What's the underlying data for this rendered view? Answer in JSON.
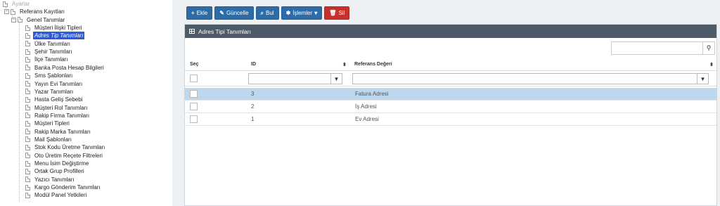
{
  "tree": {
    "items": [
      {
        "label": "Ayarlar",
        "level": 0,
        "type": "root"
      },
      {
        "label": "Referans Kayıtları",
        "level": 1,
        "type": "folder"
      },
      {
        "label": "Genel Tanımlar",
        "level": 2,
        "type": "folder"
      },
      {
        "label": "Müşteri İlişki Tipleri",
        "level": 3,
        "type": "leaf"
      },
      {
        "label": "Adres Tip Tanımları",
        "level": 3,
        "type": "leaf",
        "selected": true
      },
      {
        "label": "Ülke Tanımları",
        "level": 3,
        "type": "leaf"
      },
      {
        "label": "Şehir Tanımları",
        "level": 3,
        "type": "leaf"
      },
      {
        "label": "İlçe Tanımları",
        "level": 3,
        "type": "leaf"
      },
      {
        "label": "Banka Posta Hesap Bilgileri",
        "level": 3,
        "type": "leaf"
      },
      {
        "label": "Sms Şablonları",
        "level": 3,
        "type": "leaf"
      },
      {
        "label": "Yayın Evi Tanımları",
        "level": 3,
        "type": "leaf"
      },
      {
        "label": "Yazar Tanımları",
        "level": 3,
        "type": "leaf"
      },
      {
        "label": "Hasta Geliş Sebebi",
        "level": 3,
        "type": "leaf"
      },
      {
        "label": "Müşteri Rol Tanımları",
        "level": 3,
        "type": "leaf"
      },
      {
        "label": "Rakip Firma Tanımları",
        "level": 3,
        "type": "leaf"
      },
      {
        "label": "Müşteri Tipleri",
        "level": 3,
        "type": "leaf"
      },
      {
        "label": "Rakip Marka Tanımları",
        "level": 3,
        "type": "leaf"
      },
      {
        "label": "Mail Şablonları",
        "level": 3,
        "type": "leaf"
      },
      {
        "label": "Stok Kodu Üretme Tanımları",
        "level": 3,
        "type": "leaf"
      },
      {
        "label": "Oto Üretim Reçete Filtreleri",
        "level": 3,
        "type": "leaf"
      },
      {
        "label": "Menu İsim Değiştirme",
        "level": 3,
        "type": "leaf"
      },
      {
        "label": "Ortak Grup Profilleri",
        "level": 3,
        "type": "leaf"
      },
      {
        "label": "Yazıcı Tanımları",
        "level": 3,
        "type": "leaf"
      },
      {
        "label": "Kargo Gönderim Tanımları",
        "level": 3,
        "type": "leaf"
      },
      {
        "label": "Modül Panel Yetkileri",
        "level": 3,
        "type": "leaf"
      }
    ]
  },
  "toolbar": {
    "add_label": "Ekle",
    "update_label": "Güncelle",
    "find_label": "Bul",
    "actions_label": "İşlemler",
    "delete_label": "Sil",
    "colors": {
      "primary": "#2d6ca6",
      "danger": "#c9302c"
    }
  },
  "panel": {
    "title": "Adres Tipi Tanımları",
    "search_value": "",
    "columns": {
      "select": "Seç",
      "id": "ID",
      "ref": "Referans Değeri"
    },
    "rows": [
      {
        "id": "3",
        "ref": "Fatura Adresi",
        "selected": true
      },
      {
        "id": "2",
        "ref": "İş Adresi",
        "selected": false
      },
      {
        "id": "1",
        "ref": "Ev Adresi",
        "selected": false
      }
    ],
    "colors": {
      "header_bg": "#4d5a68",
      "row_selected": "#bcd7ee"
    }
  }
}
